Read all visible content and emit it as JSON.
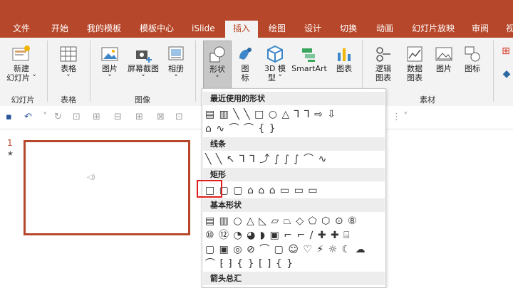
{
  "tabs": [
    "文件",
    "开始",
    "我的模板",
    "模板中心",
    "iSlide",
    "插入",
    "绘图",
    "设计",
    "切换",
    "动画",
    "幻灯片放映",
    "审阅",
    "视"
  ],
  "active_tab": "插入",
  "ribbon": {
    "new_slide": {
      "line1": "新建",
      "line2": "幻灯片 ˅"
    },
    "table": "表格",
    "picture": "图片",
    "screenshot": "屏幕截图",
    "album": "相册",
    "shapes": "形状",
    "icons": {
      "line1": "图",
      "line2": "标"
    },
    "model3d": {
      "line1": "3D 模",
      "line2": "型 ˅"
    },
    "smartart": "SmartArt",
    "chart": "图表",
    "logic_chart": {
      "line1": "逻辑",
      "line2": "图表"
    },
    "data_chart": {
      "line1": "数据",
      "line2": "图表"
    },
    "pic2": "图片",
    "icon2": "图标"
  },
  "groups": {
    "slides": "幻灯片",
    "tables": "表格",
    "images": "图像",
    "material": "素材"
  },
  "slide_number": "1",
  "slide_star": "★",
  "dropdown": {
    "recent": "最近使用的形状",
    "lines": "线条",
    "rect": "矩形",
    "basic": "基本形状",
    "arrows": "箭头总汇"
  },
  "shape_rows": {
    "recent1": "▤ ▥ ╲ ╲ □ ○ △ ⅂ ⅂ ⇨ ⇩",
    "recent2": "⌂ ∿ ⌒ ⌒ { }",
    "lines1": "╲ ╲ ↖ ⅂ ⅂ ⤴ ∫ ∫ ∫ ⌒ ∿",
    "rect1": "□ ▢ ▢ ⌂ ⌂ ⌂ ▭ ▭ ▭",
    "basic1": "▤ ▥ ○ △ ◺ ▱ ⏢ ◇ ⬠ ⬡ ⊙ ⑧",
    "basic2": "⑩ ⑫ ◔ ◕ ◗ ▣ ⌐ ⌐ ∕ ✚ ✚ ⌸",
    "basic3": "▢ ▣ ◎ ⊘ ⌒ ▢ ☺ ♡ ⚡ ☼ ☾ ☁",
    "basic4": "⌒ ⁅ ⁆ { } [ ] { }"
  },
  "qat_icons": [
    "save-icon",
    "undo-icon",
    "redo-icon",
    "presenter-icon"
  ]
}
